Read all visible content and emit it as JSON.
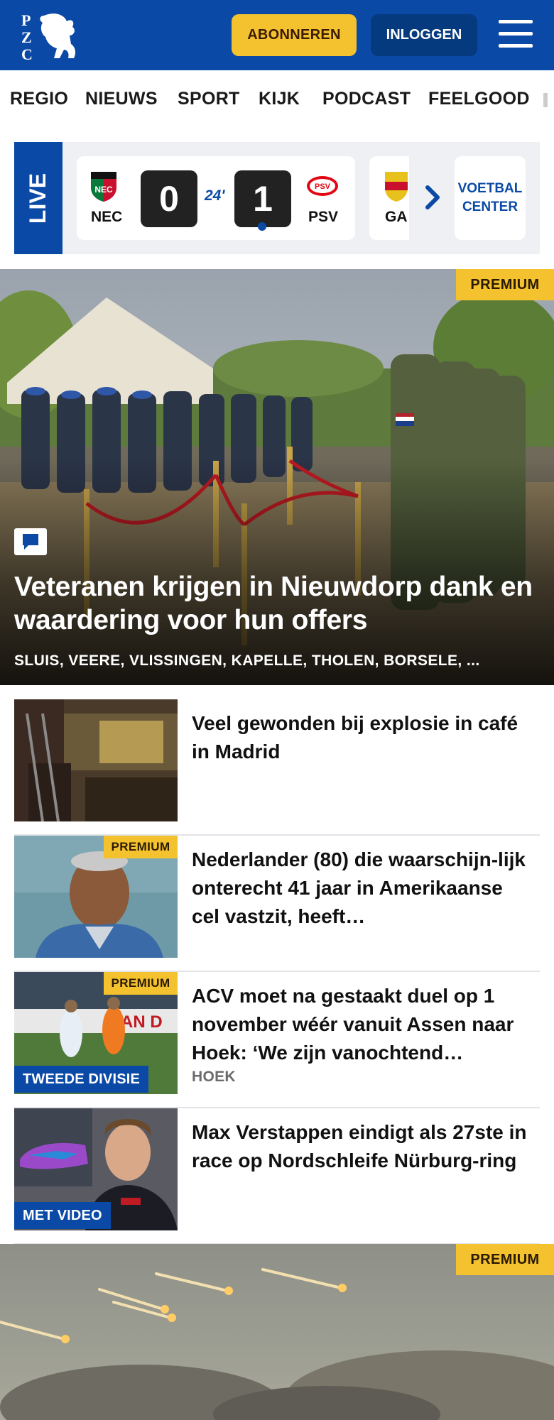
{
  "header": {
    "logo_alt": "PZC",
    "subscribe_label": "ABONNEREN",
    "login_label": "INLOGGEN",
    "menu_icon": "hamburger-menu-icon",
    "brand_color": "#0a4aa6",
    "accent_color": "#f4c12f"
  },
  "nav": {
    "items": [
      "REGIO",
      "NIEUWS",
      "SPORT",
      "KIJK",
      "PODCAST",
      "FEELGOOD"
    ]
  },
  "live": {
    "label": "LIVE",
    "match": {
      "home_team": "NEC",
      "away_team": "PSV",
      "home_score": "0",
      "away_score": "1",
      "minute": "24'"
    },
    "next_match_team": "GA",
    "voetbal_center": "VOETBAL CENTER"
  },
  "hero": {
    "premium": "PREMIUM",
    "title": "Veteranen krijgen in Nieuwdorp dank en waardering voor hun offers",
    "tags": "SLUIS, VEERE, VLISSINGEN, KAPELLE, THOLEN, BORSELE, ..."
  },
  "articles": [
    {
      "title": "Veel gewonden bij explosie in café in Madrid"
    },
    {
      "premium": "PREMIUM",
      "title": "Nederlander (80) die waarschijn-lijk onterecht 41 jaar in Amerikaanse cel vastzit, heeft…"
    },
    {
      "premium": "PREMIUM",
      "badge": "TWEEDE DIVISIE",
      "title": "ACV moet na gestaakt duel op 1 november wéér vanuit Assen naar Hoek: ‘We zijn vanochtend…",
      "label": "HOEK"
    },
    {
      "badge": "MET VIDEO",
      "title": "Max Verstappen eindigt als 27ste in race op Nordschleife Nürburg-ring"
    }
  ],
  "bottom_hero": {
    "premium": "PREMIUM"
  }
}
